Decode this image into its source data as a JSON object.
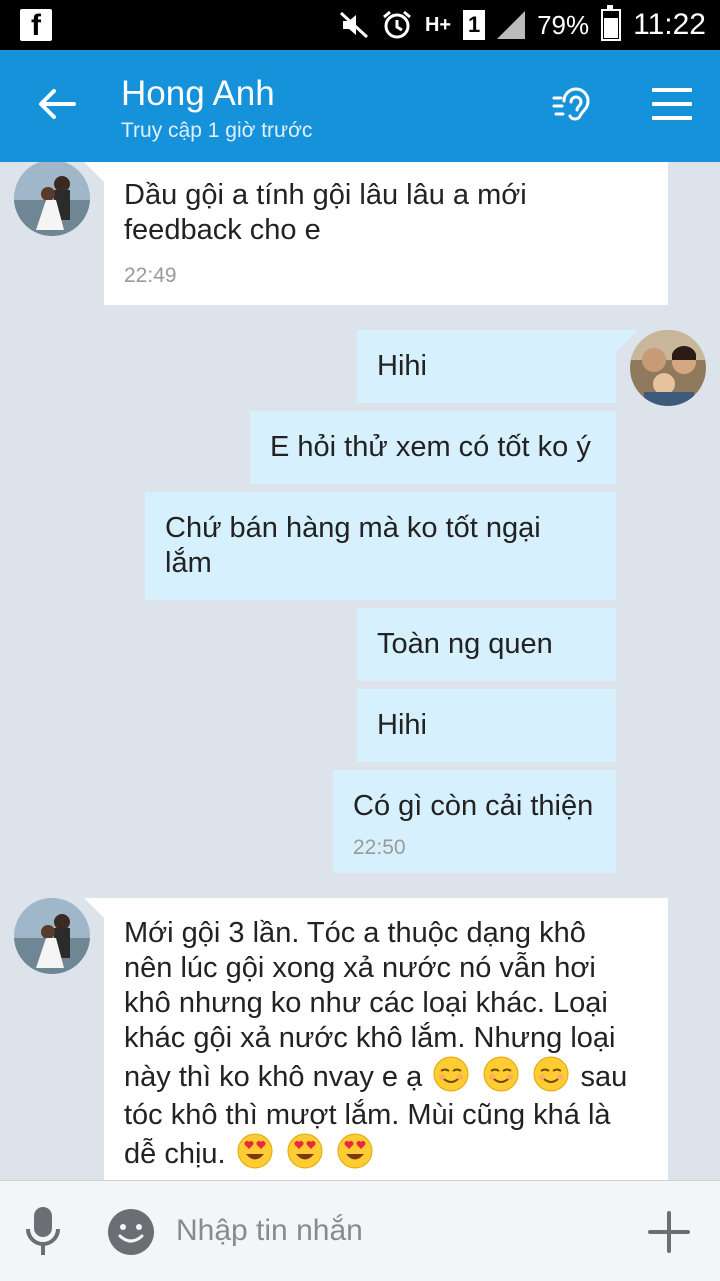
{
  "status_bar": {
    "battery": "79%",
    "time": "11:22",
    "network": "H+",
    "sim": "1"
  },
  "header": {
    "title": "Hong Anh",
    "subtitle": "Truy cập 1 giờ trước"
  },
  "messages": [
    {
      "lines": [
        "Dầu gội a tính gội lâu lâu a mới",
        "feedback cho e"
      ],
      "time": "22:49"
    },
    {
      "text": "Hihi"
    },
    {
      "text": "E hỏi thử xem có tốt ko ý"
    },
    {
      "lines": [
        "Chứ bán hàng mà ko tốt ngại",
        "lắm"
      ]
    },
    {
      "text": "Toàn ng quen"
    },
    {
      "text": "Hihi"
    },
    {
      "text": "Có gì còn cải thiện",
      "time": "22:50"
    },
    {
      "lines": [
        "Mới gội 3 lần. Tóc a thuộc dạng khô",
        "nên lúc gội xong xả nước nó vẫn hơi",
        "khô nhưng ko như các loại khác. Loại",
        "khác gội xả nước khô lắm. Nhưng loại",
        "này thì ko khô nvay e ạ",
        "sau",
        "tóc khô thì mượt lắm. Mùi cũng khá là",
        "dễ chịu."
      ]
    }
  ],
  "composer": {
    "placeholder": "Nhập tin nhắn"
  },
  "icons": {
    "back": "arrow-left-icon",
    "listen": "ear-icon",
    "menu": "hamburger-menu-icon",
    "mic": "microphone-icon",
    "emoji": "smiley-icon",
    "add": "plus-icon"
  },
  "colors": {
    "header": "#1592d9",
    "background": "#dde3ea",
    "incoming_bubble": "#ffffff",
    "outgoing_bubble": "#d7f0fd"
  }
}
